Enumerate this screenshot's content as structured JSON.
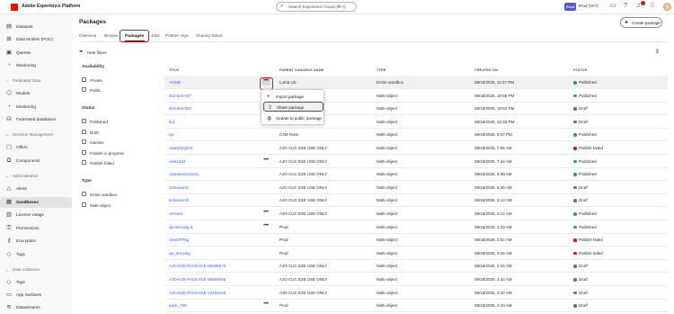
{
  "topbar": {
    "app_title": "Adobe Experience Platform",
    "search_placeholder": "Search Experience Cloud (⌘+/)",
    "org_badge": "Prod",
    "sandbox": "Prod (VA7)"
  },
  "sidebar": {
    "items_top": [
      {
        "label": "Datasets",
        "icon": "datasets-icon"
      },
      {
        "label": "Data Models (POC)",
        "icon": "data-models-icon"
      },
      {
        "label": "Queries",
        "icon": "queries-icon"
      },
      {
        "label": "Monitoring",
        "icon": "monitoring-icon"
      }
    ],
    "section_federated": "Federated Data",
    "items_federated": [
      {
        "label": "Models",
        "icon": "models-icon"
      },
      {
        "label": "Monitoring",
        "icon": "monitoring-icon"
      },
      {
        "label": "Federated databases",
        "icon": "database-icon"
      }
    ],
    "section_decision": "Decision Management",
    "items_decision": [
      {
        "label": "Offers",
        "icon": "offers-icon"
      },
      {
        "label": "Components",
        "icon": "components-icon"
      }
    ],
    "section_admin": "Administration",
    "items_admin": [
      {
        "label": "Alerts",
        "icon": "alerts-icon"
      },
      {
        "label": "Sandboxes",
        "icon": "sandboxes-icon"
      },
      {
        "label": "License Usage",
        "icon": "license-icon"
      },
      {
        "label": "Permissions",
        "icon": "permissions-icon"
      },
      {
        "label": "Encryption",
        "icon": "encryption-icon"
      },
      {
        "label": "Tags",
        "icon": "tags-icon"
      }
    ],
    "section_collection": "Data Collection",
    "items_collection": [
      {
        "label": "Tags",
        "icon": "tags-icon"
      },
      {
        "label": "App Surfaces",
        "icon": "app-surfaces-icon"
      },
      {
        "label": "Datastreams",
        "icon": "datastreams-icon"
      }
    ]
  },
  "main": {
    "title": "Packages",
    "create_button": "Create package",
    "tabs": [
      "Overview",
      "Browse",
      "Packages",
      "Jobs",
      "Partner orgs",
      "Sharing status"
    ],
    "active_tab": "Packages"
  },
  "filters": {
    "hide_label": "Hide filters",
    "availability": {
      "heading": "Availability",
      "options": [
        "Private",
        "Public"
      ]
    },
    "status": {
      "heading": "Status",
      "options": [
        "Published",
        "Draft",
        "Inactive",
        "Publish in progress",
        "Publish failed"
      ]
    },
    "type": {
      "heading": "Type",
      "options": [
        "Entire sandbox",
        "Multi-object"
      ]
    }
  },
  "table": {
    "columns": [
      "TITLE",
      "PARENT SANDBOX NAME",
      "TYPE",
      "CREATED ON",
      "STATUS"
    ],
    "rows": [
      {
        "title": "ACME",
        "parent": "Luma US",
        "type": "Entire sandbox",
        "created": "08/18/2025, 11:37 PM",
        "status": "Published",
        "status_color": "#2d9d78",
        "status_italic": false,
        "more": true
      },
      {
        "title": "sb4-test-027",
        "parent": "Prod",
        "type": "Multi-object",
        "created": "08/18/2025, 10:58 PM",
        "status": "Published",
        "status_color": "#2d9d78",
        "status_italic": false,
        "more": false
      },
      {
        "title": "sb4-test-002",
        "parent": "Prod",
        "type": "Multi-object",
        "created": "08/18/2025, 10:53 PM",
        "status": "Draft",
        "status_color": "#6e6e6e",
        "status_italic": true,
        "more": false
      },
      {
        "title": "kcjl",
        "parent": "Prod",
        "type": "Multi-object",
        "created": "08/18/2025, 10:26 PM",
        "status": "Draft",
        "status_color": "#6e6e6e",
        "status_italic": true,
        "more": false
      },
      {
        "title": "qa",
        "parent": "CJM Team",
        "type": "Multi-object",
        "created": "08/18/2025, 9:37 PM",
        "status": "Published",
        "status_color": "#2d9d78",
        "status_italic": false,
        "more": false
      },
      {
        "title": "newQQQ224",
        "parent": "AJO CUC E2E USE ONLY",
        "type": "Multi-object",
        "created": "08/18/2025, 7:55 AM",
        "status": "Publish failed",
        "status_color": "#d31510",
        "status_italic": false,
        "more": false
      },
      {
        "title": "new1234",
        "parent": "AJO CUC E2E USE ONLY",
        "type": "Multi-object",
        "created": "08/18/2025, 7:44 AM",
        "status": "Published",
        "status_color": "#2d9d78",
        "status_italic": false,
        "more": true
      },
      {
        "title": "12wwwssssss31",
        "parent": "AJO CUC E2E USE ONLY",
        "type": "Multi-object",
        "created": "08/18/2025, 6:38 AM",
        "status": "Published",
        "status_color": "#2d9d78",
        "status_italic": false,
        "more": false
      },
      {
        "title": "12wwwe31",
        "parent": "AJO CUC E2E USE ONLY",
        "type": "Multi-object",
        "created": "08/18/2025, 6:26 AM",
        "status": "Draft",
        "status_color": "#6e6e6e",
        "status_italic": true,
        "more": false
      },
      {
        "title": "testamresh",
        "parent": "AJO CUC E2E USE ONLY",
        "type": "Multi-object",
        "created": "08/18/2025, 6:13 AM",
        "status": "Draft",
        "status_color": "#6e6e6e",
        "status_italic": true,
        "more": false
      },
      {
        "title": "Arrrtest",
        "parent": "AJO CUC E2E USE ONLY",
        "type": "Multi-object",
        "created": "08/18/2025, 6:12 AM",
        "status": "Published",
        "status_color": "#2d9d78",
        "status_italic": false,
        "more": true
      },
      {
        "title": "dp-test-pkg-5",
        "parent": "Prod",
        "type": "Multi-object",
        "created": "08/18/2025, 3:33 AM",
        "status": "Published",
        "status_color": "#2d9d78",
        "status_italic": false,
        "more": true
      },
      {
        "title": "newDPPkg",
        "parent": "Prod",
        "type": "Multi-object",
        "created": "08/18/2025, 3:02 AM",
        "status": "Publish failed",
        "status_color": "#d31510",
        "status_italic": false,
        "more": false
      },
      {
        "title": "dp_test-pkg",
        "parent": "Prod",
        "type": "Multi-object",
        "created": "08/18/2025, 2:45 AM",
        "status": "Publish failed",
        "status_color": "#d31510",
        "status_italic": false,
        "more": false
      },
      {
        "title": "AJO-E2E-PACKAGE-89488575",
        "parent": "AJO CUC E2E USE ONLY",
        "type": "Multi-object",
        "created": "08/18/2025, 2:44 AM",
        "status": "Draft",
        "status_color": "#6e6e6e",
        "status_italic": true,
        "more": false
      },
      {
        "title": "AJO-E2E-PACKAGE-59596556",
        "parent": "AJO CUC E2E USE ONLY",
        "type": "Multi-object",
        "created": "08/18/2025, 2:42 AM",
        "status": "Draft",
        "status_color": "#6e6e6e",
        "status_italic": true,
        "more": false
      },
      {
        "title": "AJO-E2E-PACKAGE-23454249",
        "parent": "AJO CUC E2E USE ONLY",
        "type": "Multi-object",
        "created": "08/18/2025, 2:42 AM",
        "status": "Draft",
        "status_color": "#6e6e6e",
        "status_italic": true,
        "more": false
      },
      {
        "title": "pack_780",
        "parent": "Prod",
        "type": "Multi-object",
        "created": "08/18/2025, 2:40 AM",
        "status": "Draft",
        "status_color": "#6e6e6e",
        "status_italic": true,
        "more": true
      }
    ]
  },
  "row_menu": {
    "items": [
      {
        "label": "Import package",
        "icon": "plus-icon"
      },
      {
        "label": "Share package",
        "icon": "share-icon"
      },
      {
        "label": "Update to public package",
        "icon": "globe-icon"
      }
    ]
  },
  "colors": {
    "accent": "#5258e4",
    "link": "#3b63fb",
    "highlight": "#d6141a",
    "published": "#2d9d78",
    "failed": "#d31510"
  }
}
